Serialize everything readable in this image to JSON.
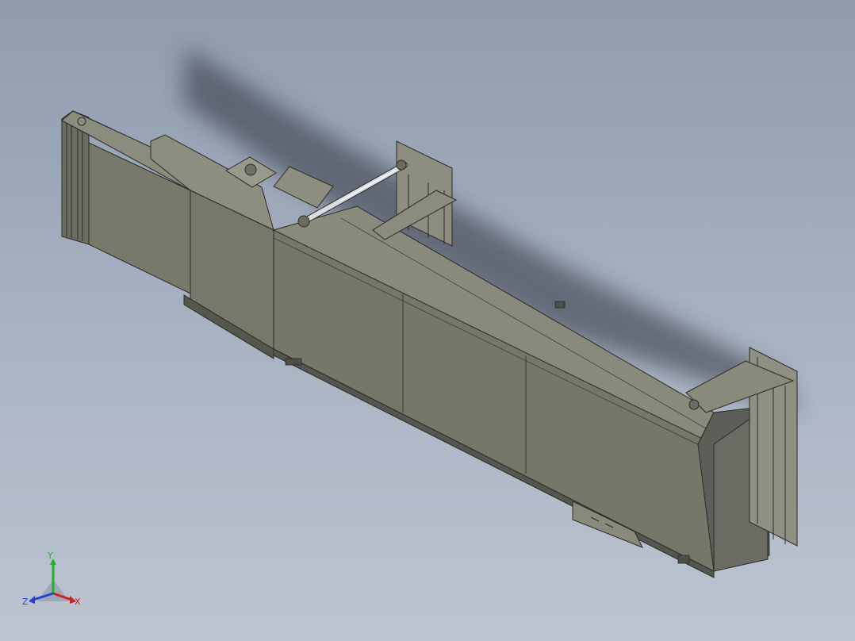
{
  "viewport": {
    "background_top": "#8e9cae",
    "background_bottom": "#bcc4d0"
  },
  "model": {
    "body_color": "#79796b",
    "body_dark": "#5f6057",
    "edge_color": "#2a2a26",
    "cylinder_color": "#d9dde2"
  },
  "triad": {
    "x_label": "X",
    "y_label": "Y",
    "z_label": "Z",
    "x_color": "#d01f1f",
    "y_color": "#1fb31f",
    "z_color": "#2244cc"
  }
}
